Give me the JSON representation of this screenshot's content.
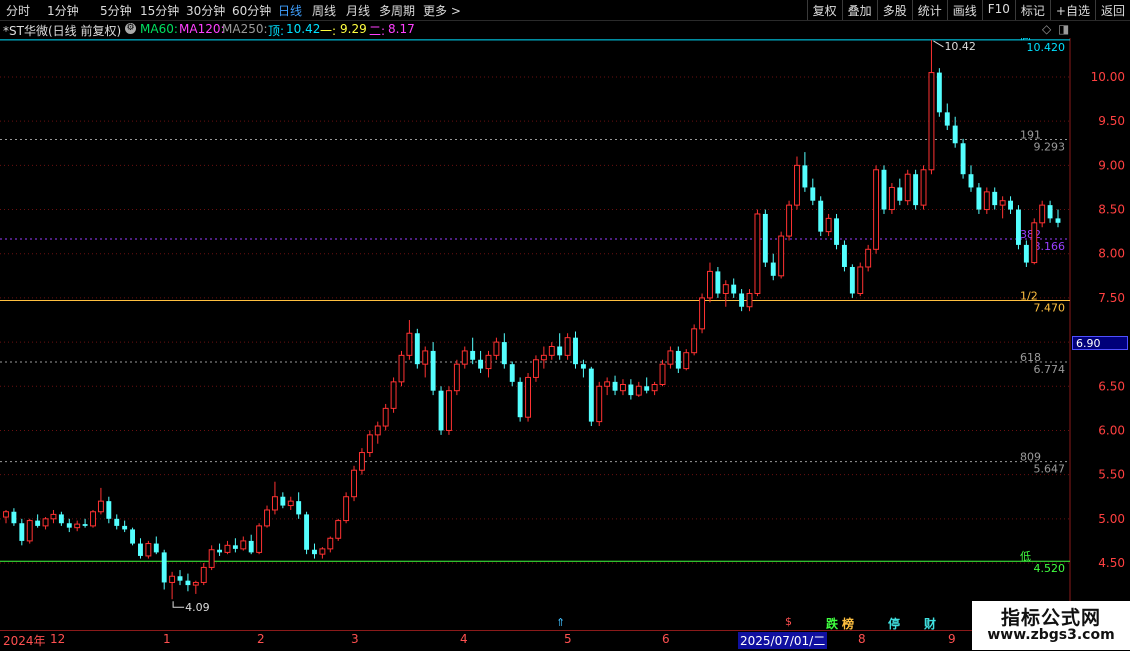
{
  "topbar": {
    "periods": [
      "分时",
      "1分钟",
      "5分钟",
      "15分钟",
      "30分钟",
      "60分钟",
      "日线",
      "周线",
      "月线",
      "多周期",
      "更多 >"
    ],
    "active_period": "日线",
    "tools": [
      "复权",
      "叠加",
      "多股",
      "统计",
      "画线",
      "F10",
      "标记",
      "+自选",
      "返回"
    ]
  },
  "info": {
    "title": "*ST华微(日线 前复权)",
    "ma60": "MA60:",
    "ma120": "MA120:",
    "ma250": "MA250:",
    "top_label": "顶:",
    "top_value": "10.42",
    "one_label": "一:",
    "one_value": "9.29",
    "two_label": "二:",
    "two_value": "8.17",
    "colors": {
      "ma60": "#00e060",
      "ma120": "#ff40ff",
      "ma250": "#9a9a9a",
      "top": "#00e0ff",
      "one": "#ffff40",
      "two": "#ff40ff"
    }
  },
  "chart_data": {
    "type": "candlestick",
    "y_ticks": [
      "10.00",
      "9.50",
      "9.00",
      "8.50",
      "8.00",
      "7.50",
      "7.00",
      "6.50",
      "6.00",
      "5.50",
      "5.00",
      "4.50"
    ],
    "ylim": [
      4.0,
      10.5
    ],
    "x_ticks": [
      "2024年",
      "12",
      "1",
      "2",
      "3",
      "4",
      "5",
      "6",
      "7",
      "8",
      "9"
    ],
    "current_price_tag": "6.90",
    "high_annotation": "10.42",
    "low_annotation": "4.09",
    "fib_levels": [
      {
        "label": "高",
        "value": "10.420",
        "price": 10.42,
        "color": "#00e0ff"
      },
      {
        "label": "191",
        "value": "9.293",
        "price": 9.293,
        "color": "#9a9a9a"
      },
      {
        "label": "382",
        "value": "8.166",
        "price": 8.166,
        "color": "#9a40ff"
      },
      {
        "label": "1/2",
        "value": "7.470",
        "price": 7.47,
        "color": "#ffc040"
      },
      {
        "label": "618",
        "value": "6.774",
        "price": 6.774,
        "color": "#9a9a9a"
      },
      {
        "label": "809",
        "value": "5.647",
        "price": 5.647,
        "color": "#9a9a9a"
      },
      {
        "label": "低",
        "value": "4.520",
        "price": 4.52,
        "color": "#40ff40"
      }
    ],
    "candles": [
      [
        5.02,
        5.1,
        4.95,
        5.08
      ],
      [
        5.08,
        5.12,
        4.92,
        4.95
      ],
      [
        4.95,
        5.0,
        4.7,
        4.75
      ],
      [
        4.75,
        5.0,
        4.72,
        4.98
      ],
      [
        4.98,
        5.05,
        4.9,
        4.92
      ],
      [
        4.92,
        5.02,
        4.88,
        5.0
      ],
      [
        5.0,
        5.1,
        4.95,
        5.05
      ],
      [
        5.05,
        5.08,
        4.92,
        4.95
      ],
      [
        4.95,
        5.0,
        4.85,
        4.9
      ],
      [
        4.9,
        4.98,
        4.86,
        4.94
      ],
      [
        4.94,
        5.0,
        4.9,
        4.92
      ],
      [
        4.92,
        5.1,
        4.9,
        5.08
      ],
      [
        5.08,
        5.35,
        5.05,
        5.2
      ],
      [
        5.2,
        5.25,
        4.95,
        5.0
      ],
      [
        5.0,
        5.05,
        4.88,
        4.92
      ],
      [
        4.92,
        4.98,
        4.85,
        4.88
      ],
      [
        4.88,
        4.9,
        4.7,
        4.72
      ],
      [
        4.72,
        4.78,
        4.55,
        4.58
      ],
      [
        4.58,
        4.75,
        4.55,
        4.72
      ],
      [
        4.72,
        4.8,
        4.6,
        4.62
      ],
      [
        4.62,
        4.65,
        4.2,
        4.28
      ],
      [
        4.28,
        4.4,
        4.09,
        4.35
      ],
      [
        4.35,
        4.42,
        4.25,
        4.3
      ],
      [
        4.3,
        4.38,
        4.18,
        4.25
      ],
      [
        4.25,
        4.3,
        4.15,
        4.28
      ],
      [
        4.28,
        4.5,
        4.25,
        4.45
      ],
      [
        4.45,
        4.7,
        4.42,
        4.65
      ],
      [
        4.65,
        4.72,
        4.58,
        4.62
      ],
      [
        4.62,
        4.75,
        4.6,
        4.7
      ],
      [
        4.7,
        4.78,
        4.62,
        4.66
      ],
      [
        4.66,
        4.8,
        4.64,
        4.75
      ],
      [
        4.75,
        4.82,
        4.6,
        4.62
      ],
      [
        4.62,
        4.95,
        4.6,
        4.92
      ],
      [
        4.92,
        5.15,
        4.9,
        5.1
      ],
      [
        5.1,
        5.42,
        5.05,
        5.25
      ],
      [
        5.25,
        5.3,
        5.12,
        5.15
      ],
      [
        5.15,
        5.25,
        5.1,
        5.2
      ],
      [
        5.2,
        5.3,
        5.0,
        5.05
      ],
      [
        5.05,
        5.08,
        4.6,
        4.65
      ],
      [
        4.65,
        4.72,
        4.55,
        4.6
      ],
      [
        4.6,
        4.68,
        4.55,
        4.66
      ],
      [
        4.66,
        4.8,
        4.62,
        4.78
      ],
      [
        4.78,
        5.0,
        4.75,
        4.98
      ],
      [
        4.98,
        5.3,
        4.95,
        5.25
      ],
      [
        5.25,
        5.6,
        5.2,
        5.55
      ],
      [
        5.55,
        5.8,
        5.5,
        5.75
      ],
      [
        5.75,
        6.0,
        5.7,
        5.95
      ],
      [
        5.95,
        6.1,
        5.85,
        6.05
      ],
      [
        6.05,
        6.3,
        6.0,
        6.25
      ],
      [
        6.25,
        6.6,
        6.2,
        6.55
      ],
      [
        6.55,
        6.9,
        6.5,
        6.85
      ],
      [
        6.85,
        7.25,
        6.8,
        7.1
      ],
      [
        7.1,
        7.15,
        6.7,
        6.75
      ],
      [
        6.75,
        6.95,
        6.6,
        6.9
      ],
      [
        6.9,
        7.0,
        6.4,
        6.45
      ],
      [
        6.45,
        6.5,
        5.95,
        6.0
      ],
      [
        6.0,
        6.5,
        5.95,
        6.45
      ],
      [
        6.45,
        6.8,
        6.4,
        6.75
      ],
      [
        6.75,
        6.95,
        6.7,
        6.9
      ],
      [
        6.9,
        7.05,
        6.75,
        6.8
      ],
      [
        6.8,
        6.9,
        6.65,
        6.7
      ],
      [
        6.7,
        6.9,
        6.6,
        6.85
      ],
      [
        6.85,
        7.05,
        6.8,
        7.0
      ],
      [
        7.0,
        7.1,
        6.7,
        6.75
      ],
      [
        6.75,
        6.78,
        6.5,
        6.55
      ],
      [
        6.55,
        6.6,
        6.1,
        6.15
      ],
      [
        6.15,
        6.65,
        6.1,
        6.6
      ],
      [
        6.6,
        6.85,
        6.55,
        6.8
      ],
      [
        6.8,
        6.95,
        6.7,
        6.85
      ],
      [
        6.85,
        7.0,
        6.8,
        6.95
      ],
      [
        6.95,
        7.1,
        6.8,
        6.85
      ],
      [
        6.85,
        7.1,
        6.8,
        7.05
      ],
      [
        7.05,
        7.12,
        6.7,
        6.75
      ],
      [
        6.75,
        6.8,
        6.6,
        6.7
      ],
      [
        6.7,
        6.72,
        6.05,
        6.1
      ],
      [
        6.1,
        6.55,
        6.05,
        6.5
      ],
      [
        6.5,
        6.6,
        6.4,
        6.55
      ],
      [
        6.55,
        6.62,
        6.4,
        6.45
      ],
      [
        6.45,
        6.58,
        6.4,
        6.52
      ],
      [
        6.52,
        6.58,
        6.35,
        6.4
      ],
      [
        6.4,
        6.55,
        6.38,
        6.5
      ],
      [
        6.5,
        6.6,
        6.42,
        6.45
      ],
      [
        6.45,
        6.55,
        6.4,
        6.52
      ],
      [
        6.52,
        6.8,
        6.5,
        6.75
      ],
      [
        6.75,
        6.95,
        6.7,
        6.9
      ],
      [
        6.9,
        6.95,
        6.65,
        6.7
      ],
      [
        6.7,
        6.92,
        6.68,
        6.88
      ],
      [
        6.88,
        7.2,
        6.85,
        7.15
      ],
      [
        7.15,
        7.55,
        7.1,
        7.5
      ],
      [
        7.5,
        7.9,
        7.45,
        7.8
      ],
      [
        7.8,
        7.85,
        7.5,
        7.55
      ],
      [
        7.55,
        7.7,
        7.4,
        7.65
      ],
      [
        7.65,
        7.72,
        7.5,
        7.55
      ],
      [
        7.55,
        7.6,
        7.35,
        7.4
      ],
      [
        7.4,
        7.6,
        7.35,
        7.55
      ],
      [
        7.55,
        8.5,
        7.52,
        8.45
      ],
      [
        8.45,
        8.5,
        7.85,
        7.9
      ],
      [
        7.9,
        8.0,
        7.7,
        7.75
      ],
      [
        7.75,
        8.25,
        7.72,
        8.2
      ],
      [
        8.2,
        8.6,
        8.15,
        8.55
      ],
      [
        8.55,
        9.1,
        8.5,
        9.0
      ],
      [
        9.0,
        9.15,
        8.7,
        8.75
      ],
      [
        8.75,
        8.85,
        8.55,
        8.6
      ],
      [
        8.6,
        8.65,
        8.2,
        8.25
      ],
      [
        8.25,
        8.45,
        8.2,
        8.4
      ],
      [
        8.4,
        8.45,
        8.05,
        8.1
      ],
      [
        8.1,
        8.15,
        7.8,
        7.85
      ],
      [
        7.85,
        7.88,
        7.5,
        7.55
      ],
      [
        7.55,
        7.9,
        7.52,
        7.85
      ],
      [
        7.85,
        8.1,
        7.8,
        8.05
      ],
      [
        8.05,
        9.0,
        8.0,
        8.95
      ],
      [
        8.95,
        9.0,
        8.45,
        8.5
      ],
      [
        8.5,
        8.8,
        8.45,
        8.75
      ],
      [
        8.75,
        8.85,
        8.55,
        8.6
      ],
      [
        8.6,
        8.95,
        8.55,
        8.9
      ],
      [
        8.9,
        8.95,
        8.5,
        8.55
      ],
      [
        8.55,
        9.0,
        8.5,
        8.95
      ],
      [
        8.95,
        10.42,
        8.9,
        10.05
      ],
      [
        10.05,
        10.1,
        9.55,
        9.6
      ],
      [
        9.6,
        9.7,
        9.4,
        9.45
      ],
      [
        9.45,
        9.55,
        9.2,
        9.25
      ],
      [
        9.25,
        9.3,
        8.85,
        8.9
      ],
      [
        8.9,
        9.0,
        8.7,
        8.75
      ],
      [
        8.75,
        8.8,
        8.45,
        8.5
      ],
      [
        8.5,
        8.75,
        8.45,
        8.7
      ],
      [
        8.7,
        8.75,
        8.5,
        8.55
      ],
      [
        8.55,
        8.65,
        8.4,
        8.6
      ],
      [
        8.6,
        8.65,
        8.45,
        8.5
      ],
      [
        8.5,
        8.55,
        8.05,
        8.1
      ],
      [
        8.1,
        8.15,
        7.85,
        7.9
      ],
      [
        7.9,
        8.4,
        7.88,
        8.35
      ],
      [
        8.35,
        8.6,
        8.3,
        8.55
      ],
      [
        8.55,
        8.6,
        8.35,
        8.4
      ],
      [
        8.4,
        8.5,
        8.3,
        8.35
      ]
    ]
  },
  "bottom": {
    "date_badge": "2025/07/01/二",
    "markers": [
      {
        "label": "跌",
        "color": "#40ff40"
      },
      {
        "label": "榜",
        "color": "#ffc040"
      },
      {
        "label": "停",
        "color": "#40e0e0"
      },
      {
        "label": "财",
        "color": "#40e0e0"
      }
    ]
  },
  "watermark": {
    "line1": "指标公式网",
    "line2": "www.zbgs3.com"
  }
}
